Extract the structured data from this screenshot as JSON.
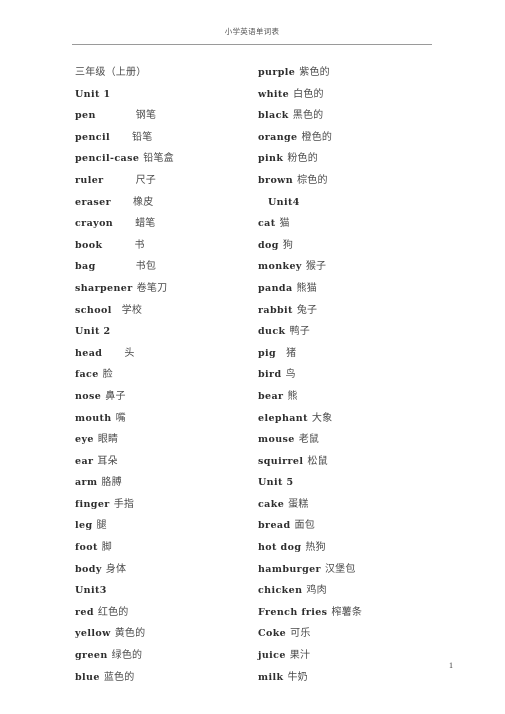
{
  "document": {
    "running_header": "小学英语单词表",
    "page_number": "1"
  },
  "columns": {
    "left": [
      {
        "en": "三年级（上册）",
        "zh": "",
        "type": "grade",
        "gap": 0
      },
      {
        "en": "Unit 1",
        "zh": "",
        "type": "unit",
        "gap": 0
      },
      {
        "en": "pen",
        "zh": "钢笔",
        "type": "word",
        "gap": 4
      },
      {
        "en": "pencil",
        "zh": "铅笔",
        "type": "word",
        "gap": 2
      },
      {
        "en": "pencil-case",
        "zh": "铅笔盒",
        "type": "word",
        "gap": 0
      },
      {
        "en": "ruler",
        "zh": "尺子",
        "type": "word",
        "gap": 3
      },
      {
        "en": "eraser",
        "zh": "橡皮",
        "type": "word",
        "gap": 2
      },
      {
        "en": "crayon",
        "zh": "蜡笔",
        "type": "word",
        "gap": 2
      },
      {
        "en": "book",
        "zh": "书",
        "type": "word",
        "gap": 3
      },
      {
        "en": "bag",
        "zh": "书包",
        "type": "word",
        "gap": 4
      },
      {
        "en": "sharpener",
        "zh": "卷笔刀",
        "type": "word",
        "gap": 0
      },
      {
        "en": "school",
        "zh": "学校",
        "type": "word",
        "gap": 1
      },
      {
        "en": "Unit 2",
        "zh": "",
        "type": "unit",
        "gap": 0
      },
      {
        "en": "head",
        "zh": "头",
        "type": "word",
        "gap": 2
      },
      {
        "en": "face",
        "zh": "脸",
        "type": "word",
        "gap": 0
      },
      {
        "en": "nose",
        "zh": "鼻子",
        "type": "word",
        "gap": 0
      },
      {
        "en": "mouth",
        "zh": "嘴",
        "type": "word",
        "gap": 0
      },
      {
        "en": "eye",
        "zh": "眼睛",
        "type": "word",
        "gap": 0
      },
      {
        "en": "ear",
        "zh": "耳朵",
        "type": "word",
        "gap": 0
      },
      {
        "en": "arm",
        "zh": "胳膊",
        "type": "word",
        "gap": 0
      },
      {
        "en": "finger",
        "zh": "手指",
        "type": "word",
        "gap": 0
      },
      {
        "en": "leg",
        "zh": "腿",
        "type": "word",
        "gap": 0
      },
      {
        "en": "foot",
        "zh": "脚",
        "type": "word",
        "gap": 0
      },
      {
        "en": "body",
        "zh": "身体",
        "type": "word",
        "gap": 0
      },
      {
        "en": "Unit3",
        "zh": "",
        "type": "unit",
        "gap": 0
      },
      {
        "en": "red",
        "zh": "红色的",
        "type": "word",
        "gap": 0
      },
      {
        "en": "yellow",
        "zh": "黄色的",
        "type": "word",
        "gap": 0
      },
      {
        "en": "green",
        "zh": "绿色的",
        "type": "word",
        "gap": 0
      },
      {
        "en": "blue",
        "zh": "蓝色的",
        "type": "word",
        "gap": 0
      }
    ],
    "right": [
      {
        "en": "purple",
        "zh": "紫色的",
        "type": "word",
        "gap": 0
      },
      {
        "en": "white",
        "zh": "白色的",
        "type": "word",
        "gap": 0
      },
      {
        "en": "black",
        "zh": "黑色的",
        "type": "word",
        "gap": 0
      },
      {
        "en": "orange",
        "zh": "橙色的",
        "type": "word",
        "gap": 0
      },
      {
        "en": "pink",
        "zh": "粉色的",
        "type": "word",
        "gap": 0
      },
      {
        "en": "brown",
        "zh": "棕色的",
        "type": "word",
        "gap": 0
      },
      {
        "en": "Unit4",
        "zh": "",
        "type": "unit-indent",
        "gap": 0
      },
      {
        "en": "cat",
        "zh": "猫",
        "type": "word",
        "gap": 0
      },
      {
        "en": "dog",
        "zh": "狗",
        "type": "word",
        "gap": 0
      },
      {
        "en": "monkey",
        "zh": "猴子",
        "type": "word",
        "gap": 0
      },
      {
        "en": "panda",
        "zh": "熊猫",
        "type": "word",
        "gap": 0
      },
      {
        "en": "rabbit",
        "zh": "兔子",
        "type": "word",
        "gap": 0
      },
      {
        "en": "duck",
        "zh": "鸭子",
        "type": "word",
        "gap": 0
      },
      {
        "en": "pig",
        "zh": "猪",
        "type": "word",
        "gap": 1
      },
      {
        "en": "bird",
        "zh": "鸟",
        "type": "word",
        "gap": 0
      },
      {
        "en": "bear",
        "zh": "熊",
        "type": "word",
        "gap": 0
      },
      {
        "en": "elephant",
        "zh": "大象",
        "type": "word",
        "gap": 0
      },
      {
        "en": "mouse",
        "zh": "老鼠",
        "type": "word",
        "gap": 0
      },
      {
        "en": "squirrel",
        "zh": "松鼠",
        "type": "word",
        "gap": 0
      },
      {
        "en": "Unit 5",
        "zh": "",
        "type": "unit",
        "gap": 0
      },
      {
        "en": "cake",
        "zh": "蛋糕",
        "type": "word",
        "gap": 0
      },
      {
        "en": "bread",
        "zh": "面包",
        "type": "word",
        "gap": 0
      },
      {
        "en": "hot dog",
        "zh": "热狗",
        "type": "word",
        "gap": 0
      },
      {
        "en": "hamburger",
        "zh": "汉堡包",
        "type": "word",
        "gap": 0
      },
      {
        "en": "chicken",
        "zh": "鸡肉",
        "type": "word",
        "gap": 0
      },
      {
        "en": "French fries",
        "zh": "榨薯条",
        "type": "word",
        "gap": 0
      },
      {
        "en": "Coke",
        "zh": "可乐",
        "type": "word",
        "gap": 0
      },
      {
        "en": "juice",
        "zh": "果汁",
        "type": "word",
        "gap": 0
      },
      {
        "en": "milk",
        "zh": "牛奶",
        "type": "word",
        "gap": 0
      }
    ]
  }
}
